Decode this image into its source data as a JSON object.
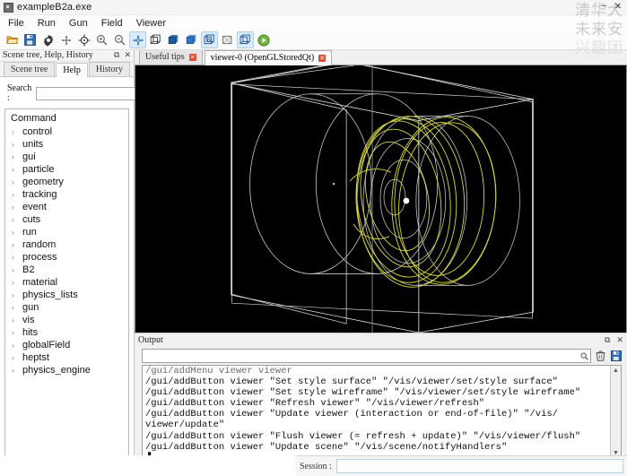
{
  "window": {
    "title": "exampleB2a.exe",
    "app_icon": "app-icon",
    "minimize": "−",
    "close": "✕"
  },
  "menu": {
    "items": [
      {
        "label": "File"
      },
      {
        "label": "Run"
      },
      {
        "label": "Gun"
      },
      {
        "label": "Field"
      },
      {
        "label": "Viewer"
      }
    ]
  },
  "toolbar": {
    "buttons": [
      {
        "name": "open-icon",
        "title": "Open macro file",
        "selected": false
      },
      {
        "name": "save-icon",
        "title": "Save viewer state",
        "selected": false
      },
      {
        "name": "gear-icon",
        "title": "Move / options",
        "selected": false
      },
      {
        "name": "move-icon",
        "title": "Move",
        "selected": false
      },
      {
        "name": "rotate-icon",
        "title": "Rotate",
        "selected": false
      },
      {
        "name": "zoom-in-icon",
        "title": "Zoom in",
        "selected": false
      },
      {
        "name": "zoom-out-icon",
        "title": "Zoom out",
        "selected": false
      },
      {
        "name": "pick-icon",
        "title": "Pick",
        "selected": true
      },
      {
        "name": "wireframe-icon",
        "title": "Wireframe style",
        "selected": false
      },
      {
        "name": "hidden-line-removal-icon",
        "title": "Hidden line removal",
        "selected": false
      },
      {
        "name": "surface-icon",
        "title": "Surface style",
        "selected": false
      },
      {
        "name": "perspective-icon",
        "title": "Perspective projection",
        "selected": true
      },
      {
        "name": "ortho-icon",
        "title": "Orthogonal projection",
        "selected": false
      },
      {
        "name": "aux-edge-icon",
        "title": "Auxiliary edges",
        "selected": true
      },
      {
        "name": "run-beam-on-icon",
        "title": "Run beam on",
        "selected": false
      }
    ]
  },
  "left_dock": {
    "title": "Scene tree, Help, History",
    "float_icon": "⧉",
    "close_icon": "✕",
    "tabs": [
      {
        "label": "Scene tree",
        "active": false
      },
      {
        "label": "Help",
        "active": true
      },
      {
        "label": "History",
        "active": false
      }
    ],
    "search": {
      "label": "Search :",
      "value": "",
      "placeholder": ""
    },
    "tree": {
      "root_label": "Command",
      "expander": "›",
      "items": [
        {
          "label": "control"
        },
        {
          "label": "units"
        },
        {
          "label": "gui"
        },
        {
          "label": "particle"
        },
        {
          "label": "geometry"
        },
        {
          "label": "tracking"
        },
        {
          "label": "event"
        },
        {
          "label": "cuts"
        },
        {
          "label": "run"
        },
        {
          "label": "random"
        },
        {
          "label": "process"
        },
        {
          "label": "B2"
        },
        {
          "label": "material"
        },
        {
          "label": "physics_lists"
        },
        {
          "label": "gun"
        },
        {
          "label": "vis"
        },
        {
          "label": "hits"
        },
        {
          "label": "globalField"
        },
        {
          "label": "heptst"
        },
        {
          "label": "physics_engine"
        }
      ]
    }
  },
  "viewer": {
    "tabs": [
      {
        "label": "Useful tips",
        "active": false,
        "close": "✕"
      },
      {
        "label": "viewer-0 (OpenGLStoredQt)",
        "active": true,
        "close": "✕"
      }
    ],
    "background_color": "#000000",
    "geometry_color": "#d8d8d8",
    "track_color": "#d6d63c",
    "hit_color": "#ffffff"
  },
  "output": {
    "title": "Output",
    "float_icon": "⧉",
    "close_icon": "✕",
    "search": {
      "value": "",
      "placeholder": ""
    },
    "search_icon": "search-icon",
    "clear_icon": "trash-icon",
    "save_icon": "save-icon",
    "scroll_up": "▲",
    "scroll_down": "▼",
    "lines": [
      "/gui/addMenu viewer viewer",
      "/gui/addButton viewer \"Set style surface\" \"/vis/viewer/set/style surface\"",
      "/gui/addButton viewer \"Set style wireframe\" \"/vis/viewer/set/style wireframe\"",
      "/gui/addButton viewer \"Refresh viewer\" \"/vis/viewer/refresh\"",
      "/gui/addButton viewer \"Update viewer (interaction or end-of-file)\" \"/vis/",
      "viewer/update\"",
      "/gui/addButton viewer \"Flush viewer (= refresh + update)\" \"/vis/viewer/flush\"",
      "/gui/addButton viewer \"Update scene\" \"/vis/scene/notifyHandlers\"",
      "▐"
    ]
  },
  "session": {
    "label": "Session :",
    "value": "",
    "placeholder": ""
  },
  "watermark": {
    "line1": "清华大",
    "line2": "未来安",
    "line3": "兴趣团"
  }
}
